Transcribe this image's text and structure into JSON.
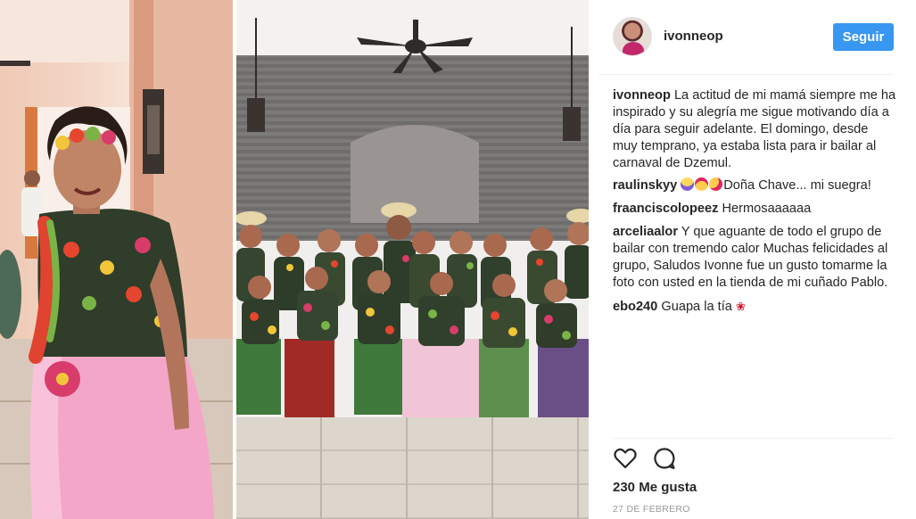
{
  "post": {
    "username": "ivonneop",
    "follow_label": "Seguir",
    "caption": {
      "author": "ivonneop",
      "text": "La actitud de mi mamá siempre me ha inspirado y su alegría me sigue motivando día a día para seguir adelante. El domingo, desde muy temprano, ya estaba lista para ir bailar al carnaval de Dzemul."
    },
    "comments": [
      {
        "author": "raulinskyy",
        "text": "Doña Chave... mi suegra!",
        "emojis": [
          "face-screaming-icon",
          "heart-eyes-icon",
          "kissing-face-icon"
        ]
      },
      {
        "author": "fraanciscolopeez",
        "text": "Hermosaaaaaa"
      },
      {
        "author": "arceliaalor",
        "text": "Y que aguante de todo el grupo de bailar con tremendo calor Muchas felicidades al grupo, Saludos Ivonne fue un gusto tomarme la foto con usted en la tienda de mi cuñado Pablo."
      },
      {
        "author": "ebo240",
        "text": "Guapa la tía",
        "emojis": [
          "rose-icon"
        ]
      }
    ],
    "likes": "230 Me gusta",
    "date": "27 DE FEBRERO",
    "icons": {
      "like": "heart-icon",
      "comment": "comment-icon"
    },
    "colors": {
      "follow_button": "#3897f0",
      "text": "#262626",
      "date": "#999999"
    }
  }
}
